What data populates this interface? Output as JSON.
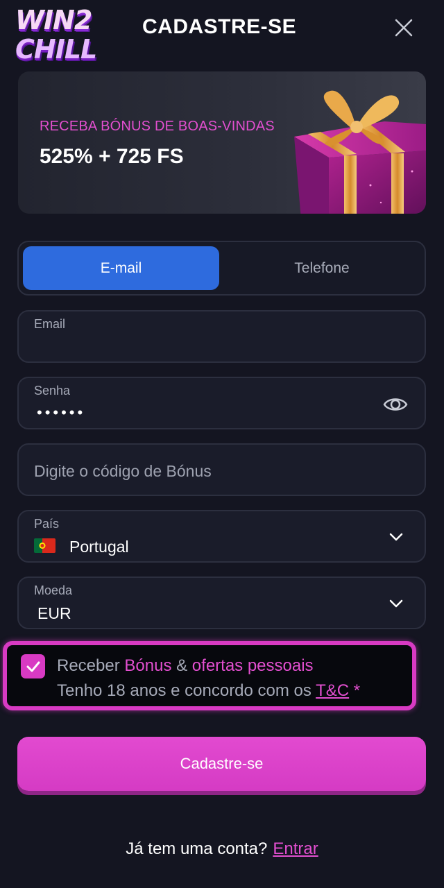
{
  "header": {
    "logo_line1": "WIN2",
    "logo_line2": "CHILL",
    "title": "CADASTRE-SE"
  },
  "banner": {
    "subtitle": "RECEBA BÓNUS DE BOAS-VINDAS",
    "headline": "525% + 725 FS"
  },
  "tabs": [
    {
      "label": "E-mail",
      "active": true
    },
    {
      "label": "Telefone",
      "active": false
    }
  ],
  "form": {
    "email": {
      "label": "Email",
      "value": ""
    },
    "password": {
      "label": "Senha",
      "value": "••••••"
    },
    "bonus": {
      "placeholder": "Digite o código de Bónus"
    },
    "country": {
      "label": "País",
      "value": "Portugal"
    },
    "currency": {
      "label": "Moeda",
      "value": "EUR"
    }
  },
  "consent": {
    "line1_prefix": "Receber ",
    "line1_link1": "Bónus",
    "line1_mid": " & ",
    "line1_link2": "ofertas pessoais",
    "line2_prefix": "Tenho 18 anos e concordo com os ",
    "line2_link": "T&C",
    "line2_suffix": " *",
    "checked": true
  },
  "submit_label": "Cadastre-se",
  "login": {
    "prompt": "Já tem uma conta?",
    "link": "Entrar"
  },
  "colors": {
    "accent_pink": "#e34fd0",
    "tab_active": "#2e6bde",
    "background": "#141521"
  }
}
